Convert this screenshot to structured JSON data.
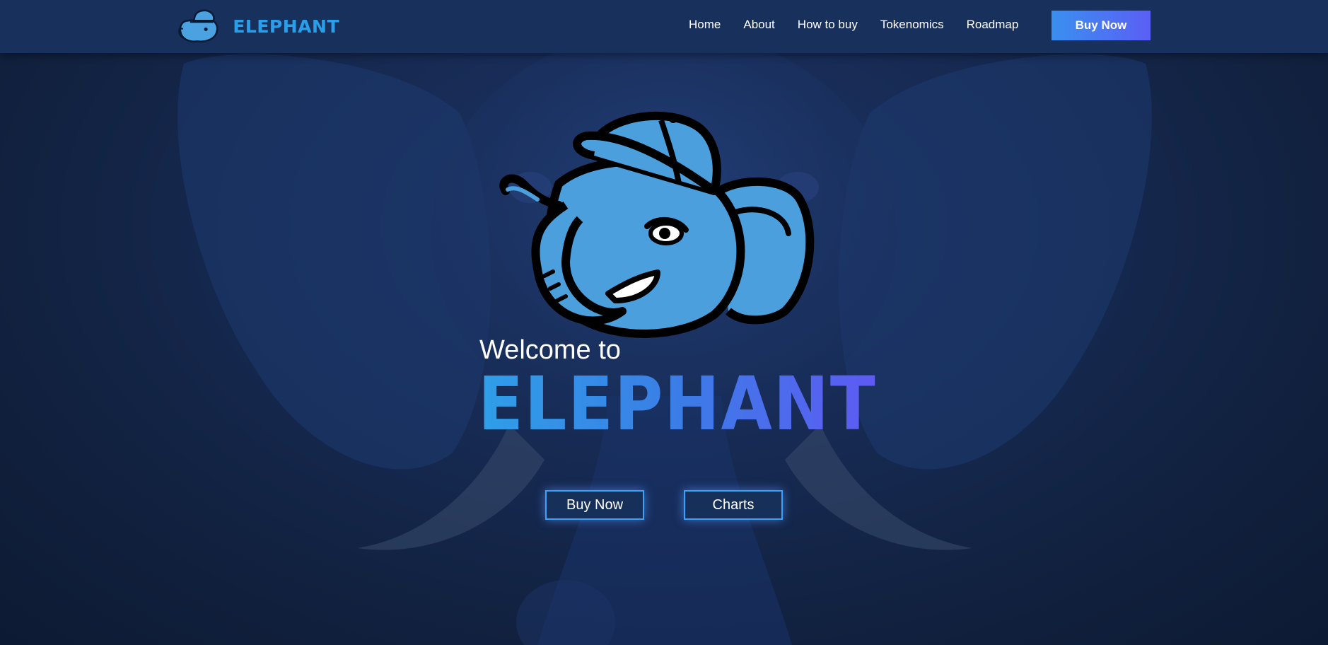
{
  "header": {
    "logo_text": "ELEPHANT",
    "logo_icon": "elephant-mascot-icon",
    "nav": [
      {
        "label": "Home"
      },
      {
        "label": "About"
      },
      {
        "label": "How to buy"
      },
      {
        "label": "Tokenomics"
      },
      {
        "label": "Roadmap"
      }
    ],
    "cta_label": "Buy Now"
  },
  "hero": {
    "mascot_icon": "elephant-mascot-icon",
    "welcome": "Welcome to",
    "brand": "ELEPHANT",
    "buttons": {
      "buy_label": "Buy Now",
      "charts_label": "Charts"
    }
  },
  "colors": {
    "background": "#111d38",
    "navbar": "#18305c",
    "accent_blue": "#2f9fe8",
    "accent_purple": "#5e5af3",
    "button_border": "#38a3ff"
  }
}
